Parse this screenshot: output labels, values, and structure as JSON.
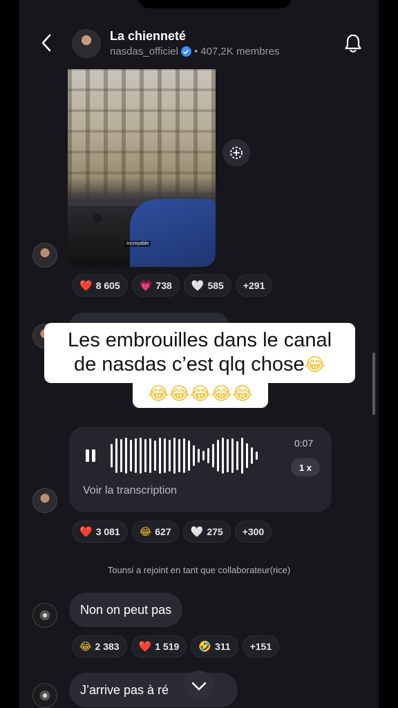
{
  "header": {
    "title": "La chienneté",
    "handle": "nasdas_officiel",
    "members": "407,2K membres",
    "separator": "•"
  },
  "media_message": {
    "caption": "Incroyable",
    "reactions": [
      {
        "icon": "❤️",
        "count": "8 605"
      },
      {
        "icon": "💗",
        "count": "738"
      },
      {
        "icon": "🤍",
        "count": "585"
      },
      {
        "icon": "",
        "count": "+291"
      }
    ]
  },
  "overlay": {
    "line1": "Les embrouilles dans le canal",
    "line2": "de nasdas c’est qlq chose",
    "line2_emoji": "😂",
    "line3_emoji": "😂😂😂😂😂"
  },
  "voice_message": {
    "duration": "0:07",
    "speed": "1 x",
    "transcript_link": "Voir la transcription",
    "reactions": [
      {
        "icon": "❤️",
        "count": "3 081"
      },
      {
        "icon": "😂",
        "count": "627"
      },
      {
        "icon": "🤍",
        "count": "275"
      },
      {
        "icon": "",
        "count": "+300"
      }
    ]
  },
  "system_notice": "Tounsi a rejoint en tant que collaborateur(rice)",
  "text_message_1": {
    "text": "Non on peut pas",
    "reactions": [
      {
        "icon": "😂",
        "count": "2 383"
      },
      {
        "icon": "❤️",
        "count": "1 519"
      },
      {
        "icon": "🤣",
        "count": "311"
      },
      {
        "icon": "",
        "count": "+151"
      }
    ]
  },
  "text_message_2": {
    "text_left": "J’arrive pas à ré",
    "text_right": "re"
  },
  "colors": {
    "background": "#16161c",
    "bubble": "#2a2a32",
    "chip": "#202027",
    "verified": "#3b8cff"
  },
  "icons": {
    "back": "chevron-left-icon",
    "bell": "bell-icon",
    "verified": "verified-badge-icon",
    "save": "save-to-collection-icon",
    "pause": "pause-icon",
    "scroll": "chevron-down-icon"
  }
}
